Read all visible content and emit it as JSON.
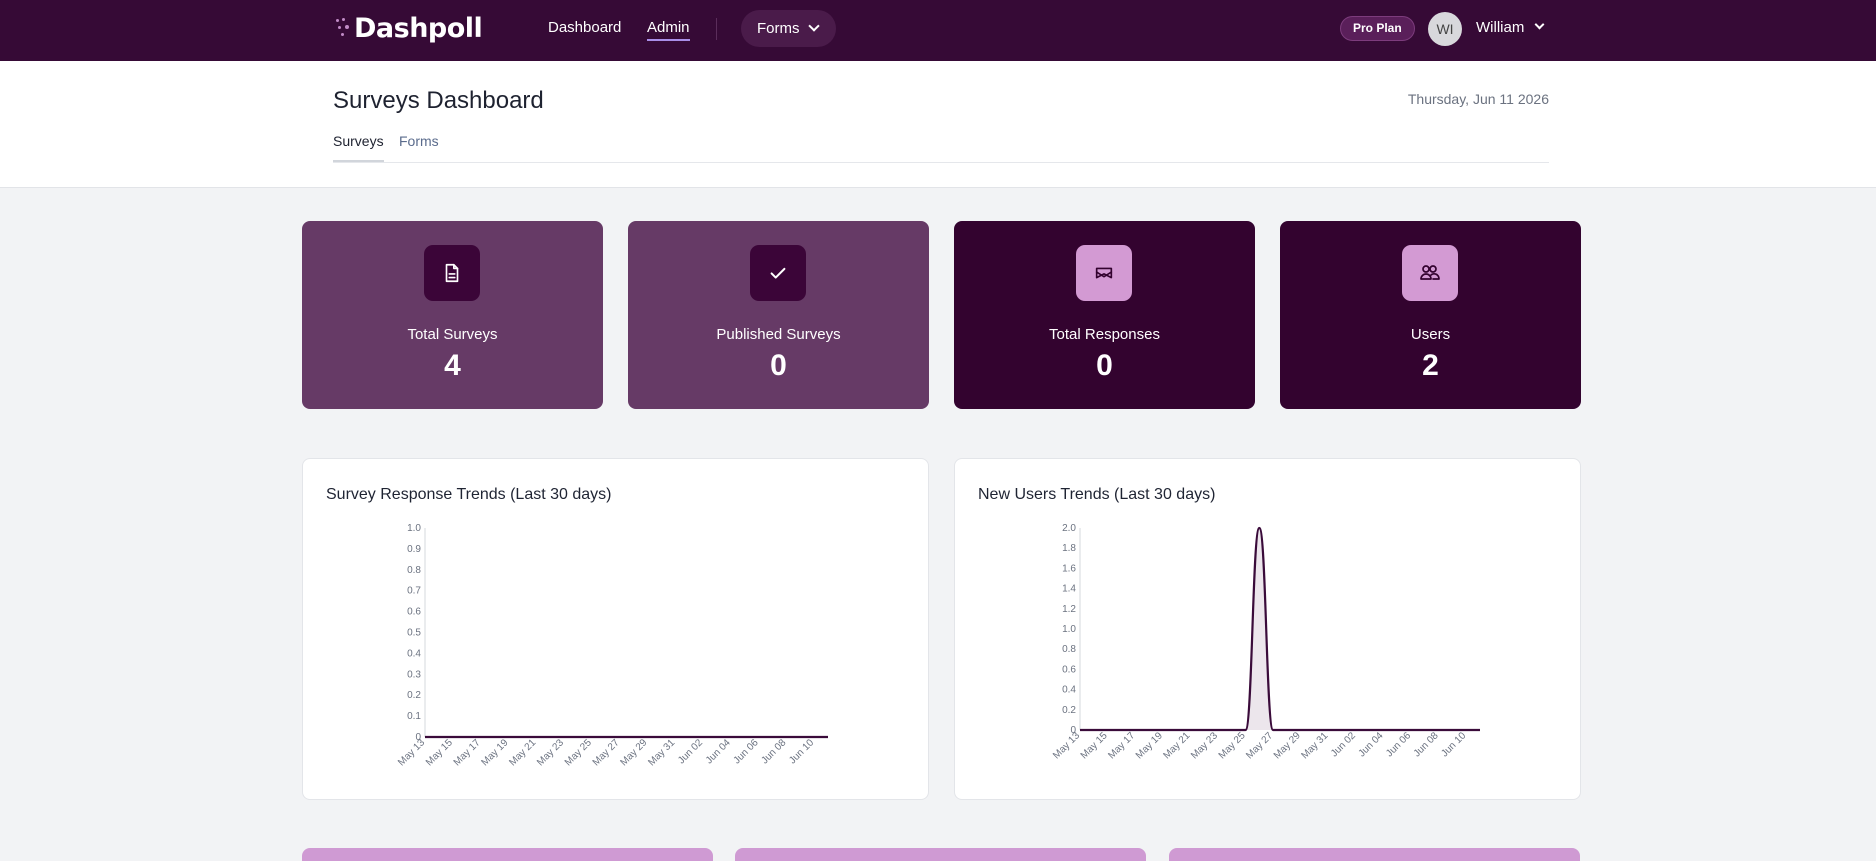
{
  "nav": {
    "logo": "Dashpoll",
    "links": [
      "Dashboard",
      "Admin"
    ],
    "forms_label": "Forms",
    "plan_badge": "Pro Plan",
    "avatar_initials": "WI",
    "user_name": "William"
  },
  "header": {
    "title": "Surveys Dashboard",
    "date": "Thursday, Jun 11 2026",
    "tabs": [
      "Surveys",
      "Forms"
    ]
  },
  "stats": [
    {
      "label": "Total Surveys",
      "value": "4",
      "icon": "document-icon"
    },
    {
      "label": "Published Surveys",
      "value": "0",
      "icon": "check-icon"
    },
    {
      "label": "Total Responses",
      "value": "0",
      "icon": "inbox-icon"
    },
    {
      "label": "Users",
      "value": "2",
      "icon": "users-icon"
    }
  ],
  "colors": {
    "nav_bg": "#360a36",
    "card_light": "#663a66",
    "card_dark": "#33032f",
    "icon_pink": "#d39ad3",
    "line": "#3a0b3a",
    "accent_underline": "#a98ee8"
  },
  "chart_data": [
    {
      "type": "line",
      "title": "Survey Response Trends (Last 30 days)",
      "xlabel": "",
      "ylabel": "",
      "ylim": [
        0,
        1.0
      ],
      "yticks": [
        "0",
        "0.1",
        "0.2",
        "0.3",
        "0.4",
        "0.5",
        "0.6",
        "0.7",
        "0.8",
        "0.9",
        "1.0"
      ],
      "xticks": [
        "May 13",
        "May 15",
        "May 17",
        "May 19",
        "May 21",
        "May 23",
        "May 25",
        "May 27",
        "May 29",
        "May 31",
        "Jun 02",
        "Jun 04",
        "Jun 06",
        "Jun 08",
        "Jun 10"
      ],
      "x": [
        "May 13",
        "May 14",
        "May 15",
        "May 16",
        "May 17",
        "May 18",
        "May 19",
        "May 20",
        "May 21",
        "May 22",
        "May 23",
        "May 24",
        "May 25",
        "May 26",
        "May 27",
        "May 28",
        "May 29",
        "May 30",
        "May 31",
        "Jun 01",
        "Jun 02",
        "Jun 03",
        "Jun 04",
        "Jun 05",
        "Jun 06",
        "Jun 07",
        "Jun 08",
        "Jun 09",
        "Jun 10",
        "Jun 11"
      ],
      "values": [
        0,
        0,
        0,
        0,
        0,
        0,
        0,
        0,
        0,
        0,
        0,
        0,
        0,
        0,
        0,
        0,
        0,
        0,
        0,
        0,
        0,
        0,
        0,
        0,
        0,
        0,
        0,
        0,
        0,
        0
      ],
      "grid": false
    },
    {
      "type": "area",
      "title": "New Users Trends (Last 30 days)",
      "xlabel": "",
      "ylabel": "",
      "ylim": [
        0,
        2.0
      ],
      "yticks": [
        "0",
        "0.2",
        "0.4",
        "0.6",
        "0.8",
        "1.0",
        "1.2",
        "1.4",
        "1.6",
        "1.8",
        "2.0"
      ],
      "xticks": [
        "May 13",
        "May 15",
        "May 17",
        "May 19",
        "May 21",
        "May 23",
        "May 25",
        "May 27",
        "May 29",
        "May 31",
        "Jun 02",
        "Jun 04",
        "Jun 06",
        "Jun 08",
        "Jun 10"
      ],
      "x": [
        "May 13",
        "May 14",
        "May 15",
        "May 16",
        "May 17",
        "May 18",
        "May 19",
        "May 20",
        "May 21",
        "May 22",
        "May 23",
        "May 24",
        "May 25",
        "May 26",
        "May 27",
        "May 28",
        "May 29",
        "May 30",
        "May 31",
        "Jun 01",
        "Jun 02",
        "Jun 03",
        "Jun 04",
        "Jun 05",
        "Jun 06",
        "Jun 07",
        "Jun 08",
        "Jun 09",
        "Jun 10",
        "Jun 11"
      ],
      "values": [
        0,
        0,
        0,
        0,
        0,
        0,
        0,
        0,
        0,
        0,
        0,
        0,
        0,
        2,
        0,
        0,
        0,
        0,
        0,
        0,
        0,
        0,
        0,
        0,
        0,
        0,
        0,
        0,
        0,
        0
      ],
      "grid": false
    }
  ]
}
